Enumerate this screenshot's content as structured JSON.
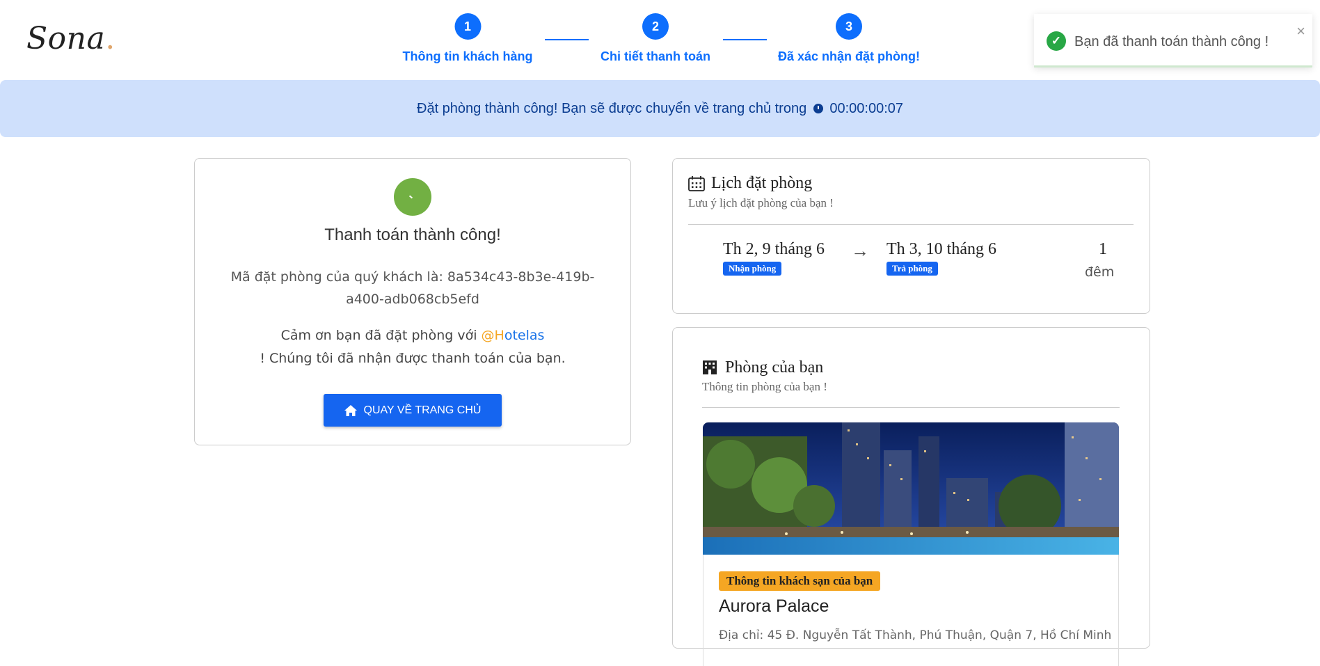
{
  "header": {
    "logo_text": "Sona",
    "logo_dot": "."
  },
  "stepper": {
    "steps": [
      {
        "number": "1",
        "label": "Thông tin khách hàng"
      },
      {
        "number": "2",
        "label": "Chi tiết thanh toán"
      },
      {
        "number": "3",
        "label": "Đã xác nhận đặt phòng!"
      }
    ]
  },
  "toast": {
    "message": "Bạn đã thanh toán thành công !",
    "close": "×"
  },
  "banner": {
    "text": "Đặt phòng thành công! Bạn sẽ được chuyển về trang chủ trong",
    "countdown": "00:00:00:07"
  },
  "payment": {
    "title": "Thanh toán thành công!",
    "code_text": "Mã đặt phòng của quý khách là: 8a534c43-8b3e-419b-a400-adb068cb5efd",
    "thanks_prefix": "Cảm ơn bạn đã đặt phòng với",
    "brand_at": "@",
    "brand_h": "H",
    "brand_rest": "otelas",
    "thanks_suffix": "! Chúng tôi đã nhận được thanh toán của bạn.",
    "home_button": "QUAY VỀ TRANG CHỦ"
  },
  "schedule": {
    "title": "Lịch đặt phòng",
    "subtitle": "Lưu ý lịch đặt phòng của bạn !",
    "checkin_date": "Th 2, 9 tháng 6",
    "checkin_label": "Nhận phòng",
    "arrow": "→",
    "checkout_date": "Th 3, 10 tháng 6",
    "checkout_label": "Trả phòng",
    "nights": "1",
    "nights_label": "đêm"
  },
  "room": {
    "title": "Phòng của bạn",
    "subtitle": "Thông tin phòng của bạn !",
    "hotel_tag": "Thông tin khách sạn của bạn",
    "hotel_name": "Aurora Palace",
    "hotel_address": "Địa chỉ: 45 Đ. Nguyễn Tất Thành, Phú Thuận, Quận 7, Hồ Chí Minh"
  },
  "colors": {
    "primary": "#0d6efd",
    "success": "#72b043",
    "banner_bg": "#cfe0fc",
    "tag": "#f5a623"
  }
}
